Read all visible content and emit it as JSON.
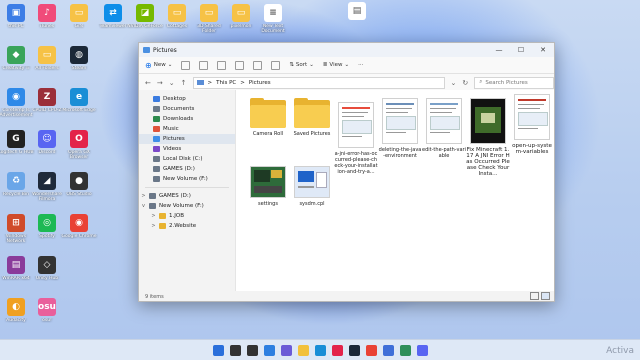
{
  "desktop": {
    "col1": [
      {
        "label": "this PC",
        "color": "#3c7de6",
        "glyph": "▣"
      },
      {
        "label": "Creativity Ti",
        "color": "#3aa45a",
        "glyph": "◆"
      },
      {
        "label": "Coretemp Is Advertisement",
        "color": "#2e89e8",
        "glyph": "◉"
      },
      {
        "label": "Logitech G HUB",
        "color": "#222222",
        "glyph": "G"
      },
      {
        "label": "Recycle Bin",
        "color": "#6aa6e8",
        "glyph": "♻"
      },
      {
        "label": "Windows Network",
        "color": "#d04b2a",
        "glyph": "⊞"
      },
      {
        "label": "WinRAR x64",
        "color": "#8a3b9a",
        "glyph": "▤"
      },
      {
        "label": "Audacity",
        "color": "#f0a020",
        "glyph": "◐"
      }
    ],
    "col2": [
      {
        "label": "iTunes",
        "color": "#f04b7a",
        "glyph": "♪"
      },
      {
        "label": "All Folders",
        "color": "#f6c246",
        "glyph": "▭"
      },
      {
        "label": "CPUID CPU-Z",
        "color": "#9b2f3a",
        "glyph": "Z"
      },
      {
        "label": "Discord",
        "color": "#5865f2",
        "glyph": "☺"
      },
      {
        "label": "Wondershare Filmora",
        "color": "#1f2a3a",
        "glyph": "◢"
      },
      {
        "label": "Spotify",
        "color": "#1db954",
        "glyph": "◎"
      },
      {
        "label": "Unity Hub",
        "color": "#333333",
        "glyph": "◇"
      },
      {
        "label": "osu!",
        "color": "#e95f9b",
        "glyph": "osu"
      }
    ],
    "col3": [
      {
        "label": "Gifs",
        "color": "#f6c246",
        "glyph": "▭"
      },
      {
        "label": "Steam",
        "color": "#1b2838",
        "glyph": "◍"
      },
      {
        "label": "Microsoft Edge",
        "color": "#1a8ed6",
        "glyph": "e"
      },
      {
        "label": "Opera GX Browser",
        "color": "#e3234a",
        "glyph": "O"
      },
      {
        "label": "OBS Studio",
        "color": "#333333",
        "glyph": "●"
      },
      {
        "label": "Google Chrome",
        "color": "#e94235",
        "glyph": "◉"
      }
    ],
    "top_row": [
      {
        "label": "Teamviewer",
        "color": "#0e8ee9",
        "glyph": "⇄"
      },
      {
        "label": "NVIDIA GeForce",
        "color": "#76b900",
        "glyph": "◪"
      },
      {
        "label": "Cottages",
        "color": "#f6c246",
        "glyph": "▭"
      },
      {
        "label": "3D Shared Folder",
        "color": "#f6c246",
        "glyph": "▭"
      },
      {
        "label": "pixelmon",
        "color": "#f6c246",
        "glyph": "▭"
      },
      {
        "label": "New Text Document",
        "color": "#ffffff",
        "glyph": "≡"
      }
    ],
    "corner_icon": {
      "label": "",
      "color": "#ffffff",
      "glyph": "▤"
    }
  },
  "window": {
    "tab_title": "Pictures",
    "toolbar": {
      "new": "New",
      "sort": "Sort",
      "view": "View",
      "more": "···"
    },
    "address": {
      "root": "This PC",
      "sep": ">",
      "current": "Pictures"
    },
    "search_placeholder": "Search Pictures",
    "sidebar": [
      {
        "label": "Desktop",
        "color": "#3a7be0",
        "chev": ""
      },
      {
        "label": "Documents",
        "color": "#6c7a8a",
        "chev": ""
      },
      {
        "label": "Downloads",
        "color": "#2d8a4e",
        "chev": ""
      },
      {
        "label": "Music",
        "color": "#e0533a",
        "chev": ""
      },
      {
        "label": "Pictures",
        "color": "#3f8ee8",
        "chev": "",
        "selected": true
      },
      {
        "label": "Videos",
        "color": "#7b48c9",
        "chev": ""
      },
      {
        "label": "Local Disk (C:)",
        "color": "#6a7788",
        "chev": ""
      },
      {
        "label": "GAMES (D:)",
        "color": "#6a7788",
        "chev": ""
      },
      {
        "label": "New Volume (F:)",
        "color": "#6a7788",
        "chev": ""
      }
    ],
    "sidebar2": [
      {
        "label": "GAMES (D:)",
        "color": "#6a7788",
        "chev": ">"
      },
      {
        "label": "New Volume (F:)",
        "color": "#6a7788",
        "chev": "v"
      },
      {
        "label": "1.JOB",
        "color": "#e8b330",
        "chev": ">"
      },
      {
        "label": "2.Website",
        "color": "#e8b330",
        "chev": ">"
      }
    ],
    "files": [
      {
        "name": "Camera Roll",
        "kind": "folder"
      },
      {
        "name": "Saved Pictures",
        "kind": "folder"
      },
      {
        "name": "a-jni-error-has-occurred-please-check-your-installation-and-try-a...",
        "kind": "thumb",
        "accent": "#e74c3c"
      },
      {
        "name": "deleting-the-java-environment",
        "kind": "thumb",
        "accent": "#6c8fb8"
      },
      {
        "name": "edit-the-path-variable",
        "kind": "thumb",
        "accent": "#7aa0c8"
      },
      {
        "name": "Fix Minecraft 1.17 A JNI Error Has Occurred Please Check Your Insta...",
        "kind": "film",
        "accent": "#3f6b2a"
      },
      {
        "name": "open-up-system-variables",
        "kind": "thumb",
        "accent": "#c0392b"
      },
      {
        "name": "settings",
        "kind": "thumb2",
        "accent": "#2e6b3a"
      },
      {
        "name": "sysdm.cpl",
        "kind": "thumb3",
        "accent": "#1f63c9"
      }
    ],
    "status": "9 items"
  },
  "taskbar": {
    "icons": [
      {
        "name": "start-icon",
        "color": "#2a6fdb"
      },
      {
        "name": "search-icon",
        "color": "#333333"
      },
      {
        "name": "task-view-icon",
        "color": "#333333"
      },
      {
        "name": "widgets-icon",
        "color": "#2d7fe0"
      },
      {
        "name": "chat-icon",
        "color": "#6b5bd6"
      },
      {
        "name": "file-explorer-icon",
        "color": "#f2c13c"
      },
      {
        "name": "edge-icon",
        "color": "#1a8ed6"
      },
      {
        "name": "opera-icon",
        "color": "#e3234a"
      },
      {
        "name": "steam-icon",
        "color": "#1b2838"
      },
      {
        "name": "chrome-icon",
        "color": "#e94235"
      },
      {
        "name": "store-icon",
        "color": "#3f6fd8"
      },
      {
        "name": "app-icon",
        "color": "#2f8f5a"
      },
      {
        "name": "discord-icon",
        "color": "#5865f2"
      }
    ]
  },
  "watermark": "Activa"
}
